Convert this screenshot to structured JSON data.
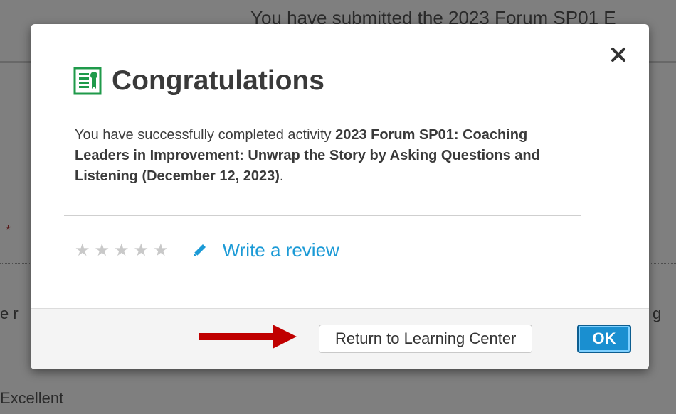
{
  "background": {
    "header_text": "You have submitted the 2023 Forum SP01 E",
    "asterisk": "*",
    "left_text": "e r",
    "right_text": "g",
    "rating_label": "Excellent"
  },
  "modal": {
    "title": "Congratulations",
    "close_symbol": "✕",
    "message_prefix": "You have successfully completed activity ",
    "activity_name": "2023 Forum SP01: Coaching Leaders in Improvement: Unwrap the Story by Asking Questions and Listening (December 12, 2023)",
    "message_suffix": ".",
    "rating": {
      "value": 0,
      "max": 5
    },
    "write_review_label": "Write a review",
    "return_button_label": "Return to Learning Center",
    "ok_button_label": "OK"
  },
  "colors": {
    "accent": "#1b9ad6",
    "icon_green": "#1f9a4a",
    "arrow_red": "#c00000",
    "star_empty": "#c9c9c9"
  },
  "icons": {
    "title": "certificate-icon",
    "review": "pencil-icon",
    "close": "close-icon",
    "annotation": "arrow-right-icon"
  }
}
